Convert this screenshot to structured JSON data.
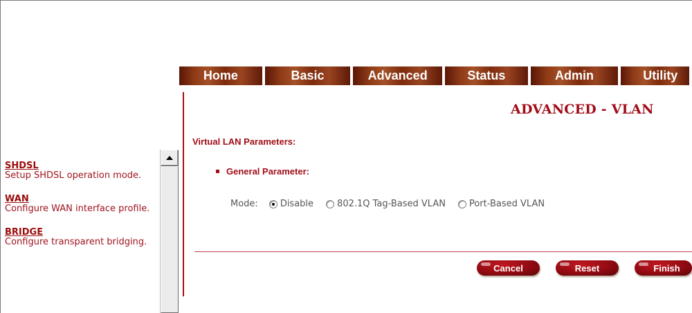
{
  "nav": {
    "tabs": [
      {
        "label": "Home"
      },
      {
        "label": "Basic"
      },
      {
        "label": "Advanced"
      },
      {
        "label": "Status"
      },
      {
        "label": "Admin"
      },
      {
        "label": "Utility"
      }
    ]
  },
  "sidebar": {
    "items": [
      {
        "title": "SHDSL",
        "desc": "Setup SHDSL operation mode."
      },
      {
        "title": "WAN",
        "desc": "Configure WAN interface profile."
      },
      {
        "title": "BRIDGE",
        "desc": "Configure transparent bridging."
      }
    ]
  },
  "page": {
    "title": "ADVANCED - VLAN",
    "section_title": "Virtual LAN Parameters:",
    "sub_title": "General Parameter:",
    "mode_label": "Mode:",
    "mode_options": [
      "Disable",
      "802.1Q Tag-Based VLAN",
      "Port-Based VLAN"
    ],
    "mode_selected": "Disable"
  },
  "buttons": {
    "cancel": "Cancel",
    "reset": "Reset",
    "finish": "Finish"
  },
  "colors": {
    "brand_red": "#a00d18",
    "nav_brown": "#8e3a16"
  }
}
